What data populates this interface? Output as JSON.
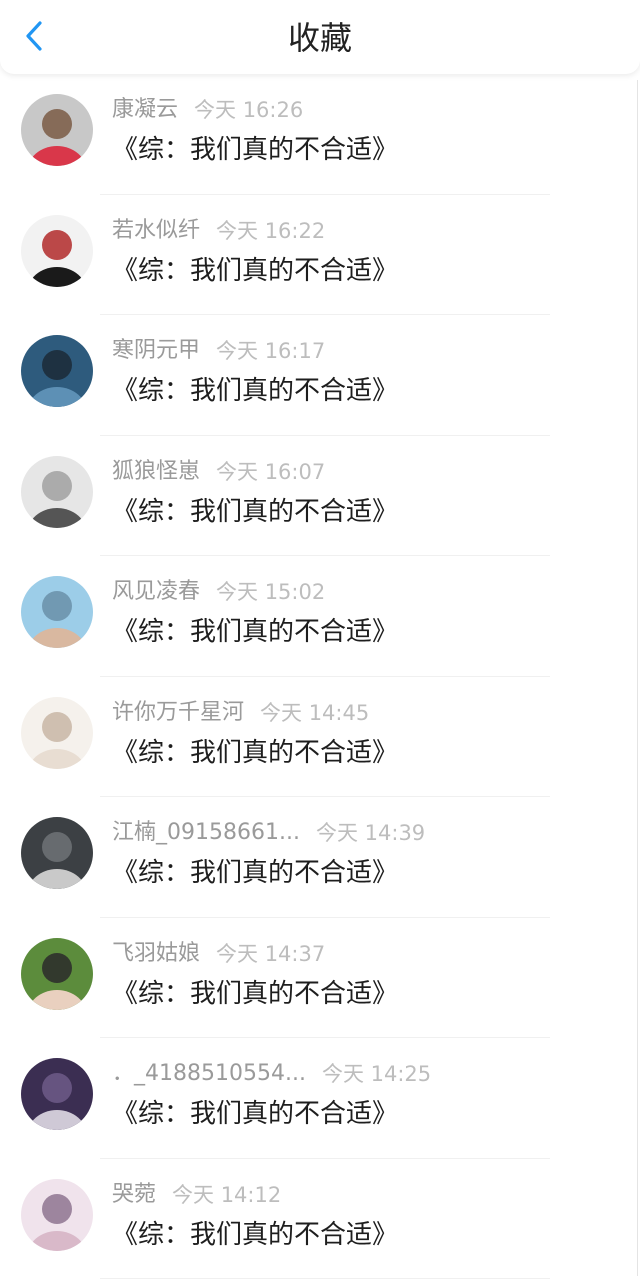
{
  "header": {
    "title": "收藏",
    "back_icon": "chevron-left-icon",
    "accent_color": "#2196f3"
  },
  "items": [
    {
      "user": "康凝云",
      "time": "今天 16:26",
      "title": "《综：我们真的不合适》",
      "avatar_colors": [
        "#c8c8c8",
        "#d9374a",
        "#7a5a44"
      ]
    },
    {
      "user": "若水似纤",
      "time": "今天 16:22",
      "title": "《综：我们真的不合适》",
      "avatar_colors": [
        "#f2f2f2",
        "#1a1a1a",
        "#b22a2a"
      ]
    },
    {
      "user": "寒阴元甲",
      "time": "今天 16:17",
      "title": "《综：我们真的不合适》",
      "avatar_colors": [
        "#2e5b7d",
        "#5d90b5",
        "#1b2a36"
      ]
    },
    {
      "user": "狐狼怪崽",
      "time": "今天 16:07",
      "title": "《综：我们真的不合适》",
      "avatar_colors": [
        "#e6e6e6",
        "#555555",
        "#a0a0a0"
      ]
    },
    {
      "user": "风见凌春",
      "time": "今天 15:02",
      "title": "《综：我们真的不合适》",
      "avatar_colors": [
        "#9ccde8",
        "#d9b8a0",
        "#6a8fa8"
      ]
    },
    {
      "user": "许你万千星河",
      "time": "今天 14:45",
      "title": "《综：我们真的不合适》",
      "avatar_colors": [
        "#f5f1ec",
        "#e8ddd2",
        "#c8b6a6"
      ]
    },
    {
      "user": "江楠_09158661...",
      "time": "今天 14:39",
      "title": "《综：我们真的不合适》",
      "avatar_colors": [
        "#3c4044",
        "#c9c9c9",
        "#6e7377"
      ]
    },
    {
      "user": "飞羽姑娘",
      "time": "今天 14:37",
      "title": "《综：我们真的不合适》",
      "avatar_colors": [
        "#5c8c3c",
        "#e9d0bf",
        "#2a2a2a"
      ]
    },
    {
      "user": "．_4188510554...",
      "time": "今天 14:25",
      "title": "《综：我们真的不合适》",
      "avatar_colors": [
        "#3b2e52",
        "#cfc9d6",
        "#6e5a88"
      ]
    },
    {
      "user": "哭菀",
      "time": "今天 14:12",
      "title": "《综：我们真的不合适》",
      "avatar_colors": [
        "#f0e3ec",
        "#d9b9c9",
        "#8e7490"
      ]
    }
  ]
}
